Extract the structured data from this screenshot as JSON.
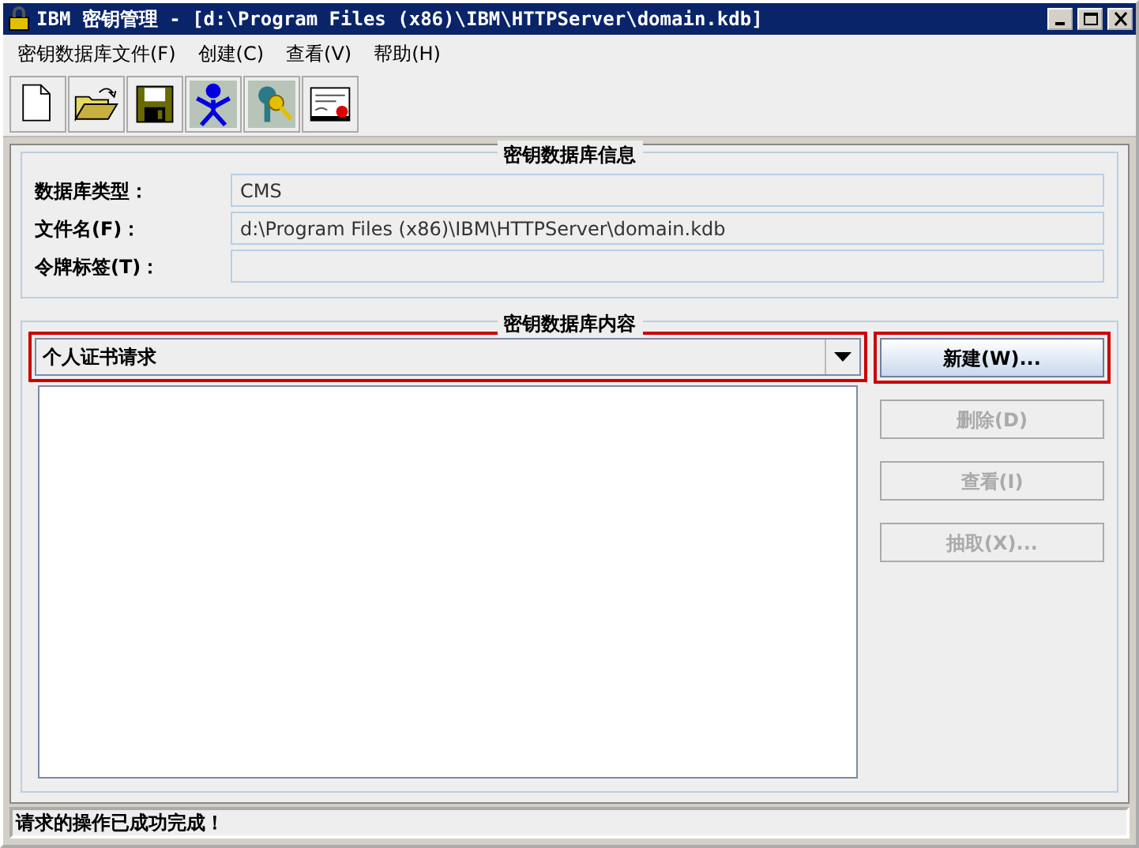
{
  "window": {
    "title": "IBM 密钥管理 - [d:\\Program Files (x86)\\IBM\\HTTPServer\\domain.kdb]"
  },
  "menu": [
    "密钥数据库文件(F)",
    "创建(C)",
    "查看(V)",
    "帮助(H)"
  ],
  "toolbar": [
    {
      "kind": "new"
    },
    {
      "kind": "open"
    },
    {
      "kind": "save"
    },
    {
      "kind": "person"
    },
    {
      "kind": "keys"
    },
    {
      "kind": "certificate"
    }
  ],
  "info": {
    "title": "密钥数据库信息",
    "fields": [
      {
        "label": "数据库类型：",
        "value": "CMS"
      },
      {
        "label": "文件名(F)：",
        "value": "d:\\Program Files (x86)\\IBM\\HTTPServer\\domain.kdb"
      },
      {
        "label": "令牌标签(T)："
      }
    ]
  },
  "content": {
    "title": "密钥数据库内容",
    "combo": {
      "value": "个人证书请求",
      "highlighted": true
    },
    "buttons": [
      {
        "label": "新建(W)...",
        "disabled": false,
        "highlighted": true
      },
      {
        "label": "删除(D)",
        "disabled": true,
        "highlighted": false
      },
      {
        "label": "查看(I)",
        "disabled": true,
        "highlighted": false
      },
      {
        "label": "抽取(X)...",
        "disabled": true,
        "highlighted": false
      }
    ]
  },
  "status_bar": "请求的操作已成功完成！"
}
